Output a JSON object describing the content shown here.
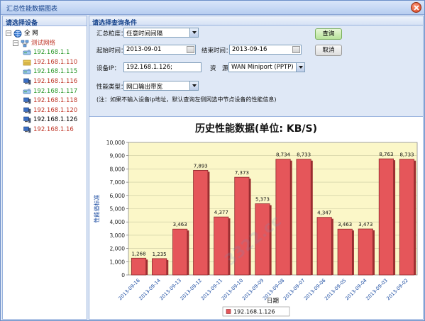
{
  "window": {
    "title": "汇总性能数据图表"
  },
  "left_panel": {
    "header": "请选择设备",
    "tree": [
      {
        "label": "全 网",
        "level": 0,
        "expander": "−",
        "icon": "globe-icon",
        "color": "#000000"
      },
      {
        "label": "测试网络",
        "level": 1,
        "expander": "−",
        "icon": "network-icon",
        "color": "#c0392b"
      },
      {
        "label": "192.168.1.1",
        "level": 2,
        "icon": "router-icon",
        "color": "#2e9a2e"
      },
      {
        "label": "192.168.1.110",
        "level": 2,
        "icon": "switch-icon",
        "color": "#c0392b"
      },
      {
        "label": "192.168.1.115",
        "level": 2,
        "icon": "router-icon",
        "color": "#2e9a2e"
      },
      {
        "label": "192.168.1.116",
        "level": 2,
        "icon": "computer-icon",
        "color": "#c0392b"
      },
      {
        "label": "192.168.1.117",
        "level": 2,
        "icon": "router-icon",
        "color": "#2e9a2e"
      },
      {
        "label": "192.168.1.118",
        "level": 2,
        "icon": "computer-icon",
        "color": "#c0392b"
      },
      {
        "label": "192.168.1.120",
        "level": 2,
        "icon": "computer-icon",
        "color": "#c0392b"
      },
      {
        "label": "192.168.1.126",
        "level": 2,
        "icon": "computer-icon",
        "color": "#000000"
      },
      {
        "label": "192.168.1.16",
        "level": 2,
        "icon": "computer-icon",
        "color": "#c0392b"
      }
    ]
  },
  "conditions": {
    "header": "请选择查询条件",
    "granularity_label": "汇总粒度：",
    "granularity_value": "任意时间间隔",
    "start_label": "起始时间：",
    "start_value": "2013-09-01",
    "end_label": "结束时间：",
    "end_value": "2013-09-16",
    "query_button": "查询",
    "cancel_button": "取消",
    "device_ip_label": "设备IP：",
    "device_ip_value": "192.168.1.126;",
    "resource_label": "资　源：",
    "resource_value": "WAN Miniport (PPTP)",
    "perf_type_label": "性能类型：",
    "perf_type_value": "网口输出带宽",
    "note": "(注：如果不输入设备ip地址，默认查询左侧网选中节点设备的性能信息)"
  },
  "chart_data": {
    "type": "bar",
    "title": "历史性能数据(单位: KB/S)",
    "xlabel": "日期",
    "ylabel": "性能值标准",
    "ylim": [
      0,
      10000
    ],
    "yticks": [
      "0",
      "1,000",
      "2,000",
      "3,000",
      "4,000",
      "5,000",
      "6,000",
      "7,000",
      "8,000",
      "9,000",
      "10,000"
    ],
    "categories": [
      "2013-09-16",
      "2013-09-14",
      "2013-09-13",
      "2013-09-12",
      "2013-09-11",
      "2013-09-10",
      "2013-09-09",
      "2013-09-08",
      "2013-09-07",
      "2013-09-06",
      "2013-09-05",
      "2013-09-04",
      "2013-09-03",
      "2013-09-02"
    ],
    "series": [
      {
        "name": "192.168.1.126",
        "color": "#e5565a",
        "values": [
          1268,
          1235,
          3463,
          7893,
          4377,
          7373,
          5373,
          8734,
          8733,
          4347,
          3463,
          3473,
          8763,
          8733
        ],
        "labels": [
          "1,268",
          "1,235",
          "3,463",
          "7,893",
          "4,377",
          "7,373",
          "5,373",
          "8,734",
          "8,733",
          "4,347",
          "3,463",
          "3,473",
          "8,763",
          "8,733"
        ]
      }
    ],
    "grid": true,
    "legend_position": "bottom-center",
    "plot_background": "#fbf7c8"
  },
  "watermark": "3322.cc"
}
